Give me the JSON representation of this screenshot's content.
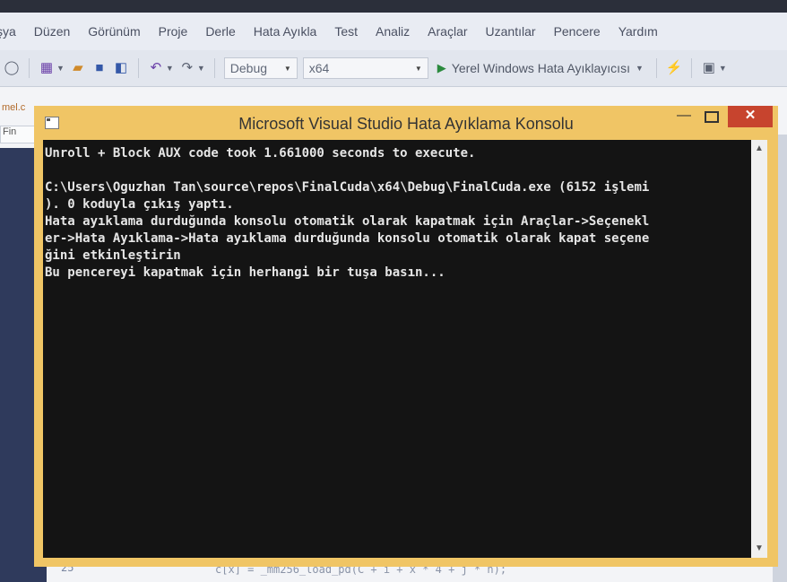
{
  "menubar": {
    "items": [
      "şya",
      "Düzen",
      "Görünüm",
      "Proje",
      "Derle",
      "Hata Ayıkla",
      "Test",
      "Analiz",
      "Araçlar",
      "Uzantılar",
      "Pencere",
      "Yardım"
    ]
  },
  "toolbar": {
    "configuration": "Debug",
    "platform": "x64",
    "debugger_label": "Yerel Windows Hata Ayıklayıcısı"
  },
  "editor": {
    "tab_label": "mel.c",
    "file_label": "Fin",
    "line_number": "25",
    "code_snippet": "c[x] = _mm256_load_pd(C + i + x * 4 + j * n);"
  },
  "console": {
    "title": "Microsoft Visual Studio Hata Ayıklama Konsolu",
    "minimize_glyph": "—",
    "close_glyph": "✕",
    "output": "Unroll + Block AUX code took 1.661000 seconds to execute.\n\nC:\\Users\\Oguzhan Tan\\source\\repos\\FinalCuda\\x64\\Debug\\FinalCuda.exe (6152 işlemi\n). 0 koduyla çıkış yaptı.\nHata ayıklama durduğunda konsolu otomatik olarak kapatmak için Araçlar->Seçenekl\ner->Hata Ayıklama->Hata ayıklama durduğunda konsolu otomatik olarak kapat seçene\nğini etkinleştirin\nBu pencereyi kapatmak için herhangi bir tuşa basın..."
  },
  "colors": {
    "console_frame": "#f0c565",
    "close_button": "#c7442e",
    "console_background": "#141414"
  }
}
